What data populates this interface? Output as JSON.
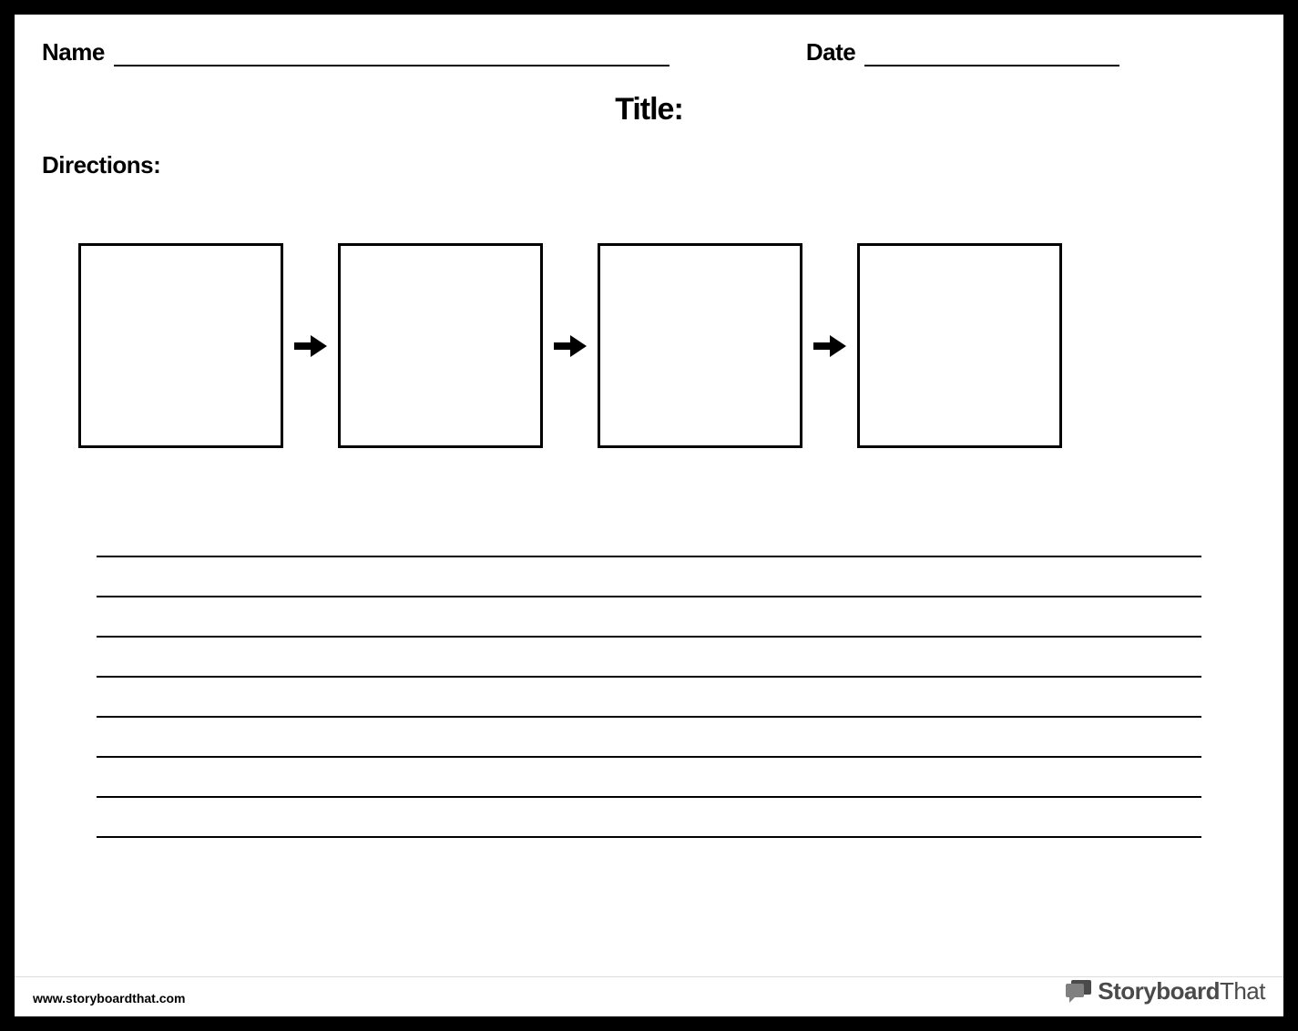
{
  "header": {
    "name_label": "Name",
    "date_label": "Date"
  },
  "title_label": "Title:",
  "directions_label": "Directions:",
  "flow": {
    "box_count": 4,
    "arrow_count": 3
  },
  "writing_lines": 8,
  "footer": {
    "url": "www.storyboardthat.com",
    "brand_bold": "Storyboard",
    "brand_light": "That"
  }
}
